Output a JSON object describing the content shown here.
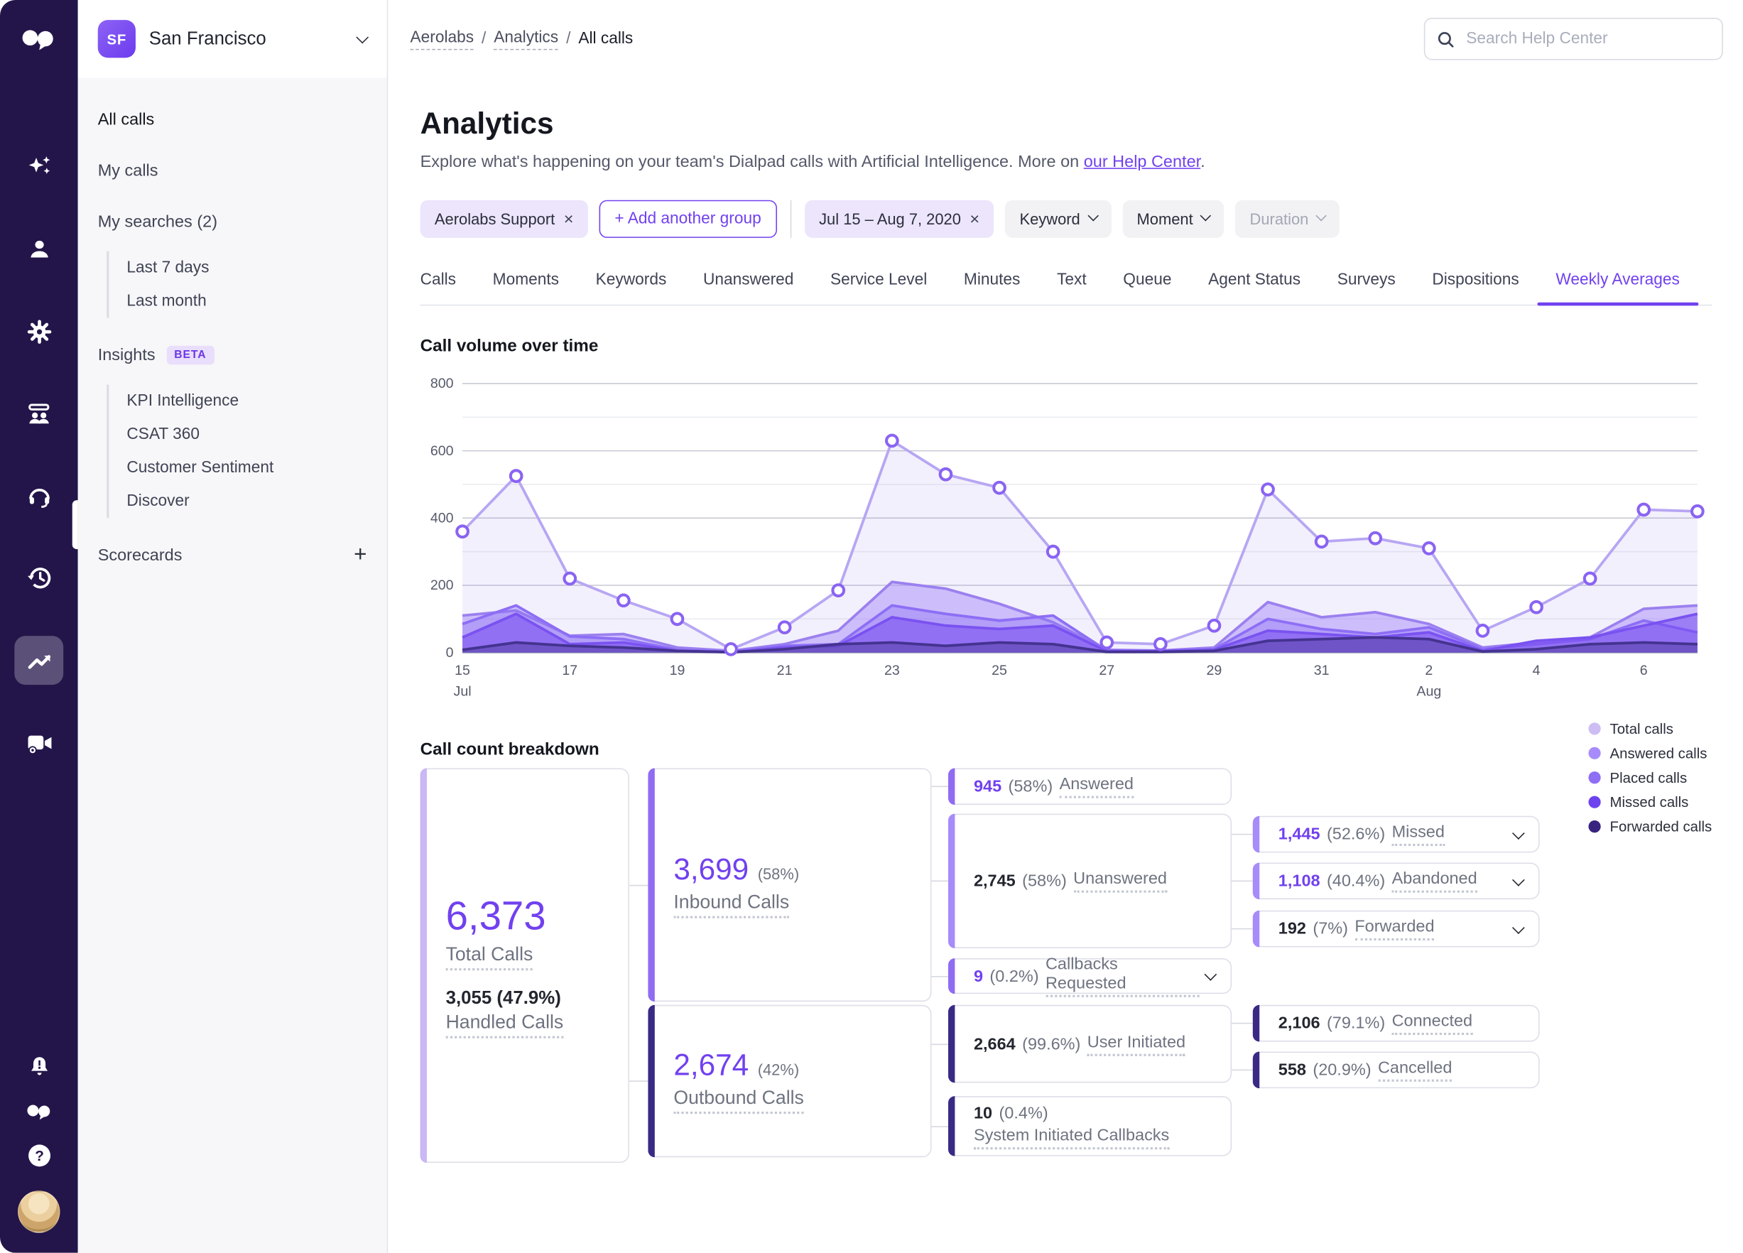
{
  "rail": {
    "icons": [
      "dialpad-logo",
      "ai-sparkles",
      "contacts",
      "settings",
      "coaching",
      "support-headset",
      "history",
      "analytics",
      "video-meetings"
    ],
    "bottom_icons": [
      "notifications-bell",
      "dialpad-mini",
      "help",
      "user-avatar"
    ],
    "active_icon": "analytics"
  },
  "sidebar": {
    "workspace": {
      "initials": "SF",
      "name": "San Francisco"
    },
    "sections": [
      {
        "type": "item",
        "label": "All calls",
        "active": true
      },
      {
        "type": "item",
        "label": "My calls"
      },
      {
        "type": "item",
        "label": "My searches (2)"
      },
      {
        "type": "group",
        "items": [
          "Last 7 days",
          "Last month"
        ]
      },
      {
        "type": "item",
        "label": "Insights",
        "badge": "BETA"
      },
      {
        "type": "group",
        "items": [
          "KPI Intelligence",
          "CSAT 360",
          "Customer Sentiment",
          "Discover"
        ]
      },
      {
        "type": "item",
        "label": "Scorecards",
        "trailing": "+"
      }
    ]
  },
  "topbar": {
    "breadcrumb": [
      "Aerolabs",
      "Analytics",
      "All calls"
    ],
    "breadcrumb_separator": "/",
    "search_placeholder": "Search Help Center"
  },
  "header": {
    "title": "Analytics",
    "description_prefix": "Explore what's happening on your team's Dialpad calls with Artificial Intelligence. More on ",
    "link_text": "our Help Center",
    "description_suffix": "."
  },
  "filters": {
    "group_chip": {
      "label": "Aerolabs Support",
      "close": "×"
    },
    "add_group_label": "+ Add another group",
    "date_chip": {
      "label": "Jul 15 – Aug 7, 2020",
      "close": "×"
    },
    "keyword_label": "Keyword",
    "moment_label": "Moment",
    "duration_label": "Duration"
  },
  "tabs": {
    "items": [
      "Calls",
      "Moments",
      "Keywords",
      "Unanswered",
      "Service Level",
      "Minutes",
      "Text",
      "Queue",
      "Agent Status",
      "Surveys",
      "Dispositions",
      "Weekly Averages"
    ],
    "active": "Weekly Averages"
  },
  "chart_data": {
    "type": "area",
    "title": "Call volume over time",
    "x_days": [
      "Jul 15",
      "Jul 16",
      "Jul 17",
      "Jul 18",
      "Jul 19",
      "Jul 20",
      "Jul 21",
      "Jul 22",
      "Jul 23",
      "Jul 24",
      "Jul 25",
      "Jul 26",
      "Jul 27",
      "Jul 28",
      "Jul 29",
      "Jul 30",
      "Jul 31",
      "Aug 1",
      "Aug 2",
      "Aug 3",
      "Aug 4",
      "Aug 5",
      "Aug 6",
      "Aug 7"
    ],
    "x_ticks": [
      {
        "i": 0,
        "label": "15",
        "sub": "Jul"
      },
      {
        "i": 2,
        "label": "17"
      },
      {
        "i": 4,
        "label": "19"
      },
      {
        "i": 6,
        "label": "21"
      },
      {
        "i": 8,
        "label": "23"
      },
      {
        "i": 10,
        "label": "25"
      },
      {
        "i": 12,
        "label": "27"
      },
      {
        "i": 14,
        "label": "29"
      },
      {
        "i": 16,
        "label": "31"
      },
      {
        "i": 18,
        "label": "2",
        "sub": "Aug"
      },
      {
        "i": 20,
        "label": "4"
      },
      {
        "i": 22,
        "label": "6"
      }
    ],
    "y_ticks": [
      0,
      200,
      400,
      600,
      800
    ],
    "ylim": [
      0,
      800
    ],
    "grid": true,
    "legend_position": "right-of-breakdown-title",
    "series": [
      {
        "name": "Total calls",
        "color": "#b7a6f3",
        "fill": "rgba(140,110,235,0.10)",
        "marker": true,
        "marker_stroke": "#8a63f2",
        "values": [
          360,
          525,
          220,
          155,
          100,
          10,
          75,
          185,
          630,
          530,
          490,
          300,
          30,
          25,
          80,
          485,
          330,
          340,
          310,
          65,
          135,
          220,
          425,
          420
        ]
      },
      {
        "name": "Answered calls",
        "color": "#9b80ef",
        "fill": "rgba(167,139,250,0.50)",
        "values": [
          110,
          125,
          50,
          55,
          15,
          5,
          25,
          65,
          210,
          190,
          145,
          90,
          8,
          6,
          15,
          150,
          105,
          120,
          85,
          15,
          30,
          45,
          130,
          140
        ]
      },
      {
        "name": "Placed calls",
        "color": "#8d6ef5",
        "fill": "rgba(141,110,245,0.40)",
        "values": [
          85,
          140,
          48,
          40,
          8,
          2,
          20,
          25,
          140,
          115,
          95,
          110,
          6,
          5,
          10,
          100,
          70,
          55,
          75,
          10,
          25,
          40,
          95,
          60
        ]
      },
      {
        "name": "Missed calls",
        "color": "#7a52f0",
        "fill": "rgba(118,74,240,0.55)",
        "values": [
          45,
          115,
          25,
          30,
          5,
          1,
          15,
          20,
          105,
          80,
          70,
          80,
          4,
          4,
          8,
          65,
          55,
          45,
          60,
          5,
          35,
          45,
          80,
          115
        ]
      },
      {
        "name": "Forwarded calls",
        "color": "#443390",
        "fill": "rgba(68,51,144,0.45)",
        "values": [
          8,
          30,
          20,
          15,
          5,
          1,
          10,
          25,
          30,
          20,
          30,
          25,
          2,
          2,
          5,
          35,
          40,
          45,
          40,
          3,
          10,
          25,
          30,
          25
        ]
      }
    ]
  },
  "breakdown": {
    "title": "Call count breakdown",
    "legend": [
      {
        "label": "Total calls",
        "color": "#cdbdf2"
      },
      {
        "label": "Answered calls",
        "color": "#a78bfa"
      },
      {
        "label": "Placed calls",
        "color": "#8d6ef5"
      },
      {
        "label": "Missed calls",
        "color": "#6d43f0"
      },
      {
        "label": "Forwarded calls",
        "color": "#38247e"
      }
    ],
    "total": {
      "value": "6,373",
      "label": "Total Calls",
      "sub_value": "3,055 (47.9%)",
      "sub_label": "Handled Calls"
    },
    "inbound": {
      "value": "3,699",
      "pct": "(58%)",
      "label": "Inbound Calls"
    },
    "outbound": {
      "value": "2,674",
      "pct": "(42%)",
      "label": "Outbound Calls"
    },
    "answered": {
      "value": "945",
      "pct": "(58%)",
      "label": "Answered"
    },
    "unanswered": {
      "value": "2,745",
      "pct": "(58%)",
      "label": "Unanswered"
    },
    "callbacks": {
      "value": "9",
      "pct": "(0.2%)",
      "label": "Callbacks Requested"
    },
    "missed": {
      "value": "1,445",
      "pct": "(52.6%)",
      "label": "Missed"
    },
    "abandoned": {
      "value": "1,108",
      "pct": "(40.4%)",
      "label": "Abandoned"
    },
    "forwarded": {
      "value": "192",
      "pct": "(7%)",
      "label": "Forwarded"
    },
    "user_initiated": {
      "value": "2,664",
      "pct": "(99.6%)",
      "label": "User Initiated"
    },
    "system_callbacks": {
      "value": "10",
      "pct": "(0.4%)",
      "label": "System Initiated Callbacks"
    },
    "connected": {
      "value": "2,106",
      "pct": "(79.1%)",
      "label": "Connected"
    },
    "cancelled": {
      "value": "558",
      "pct": "(20.9%)",
      "label": "Cancelled"
    }
  }
}
